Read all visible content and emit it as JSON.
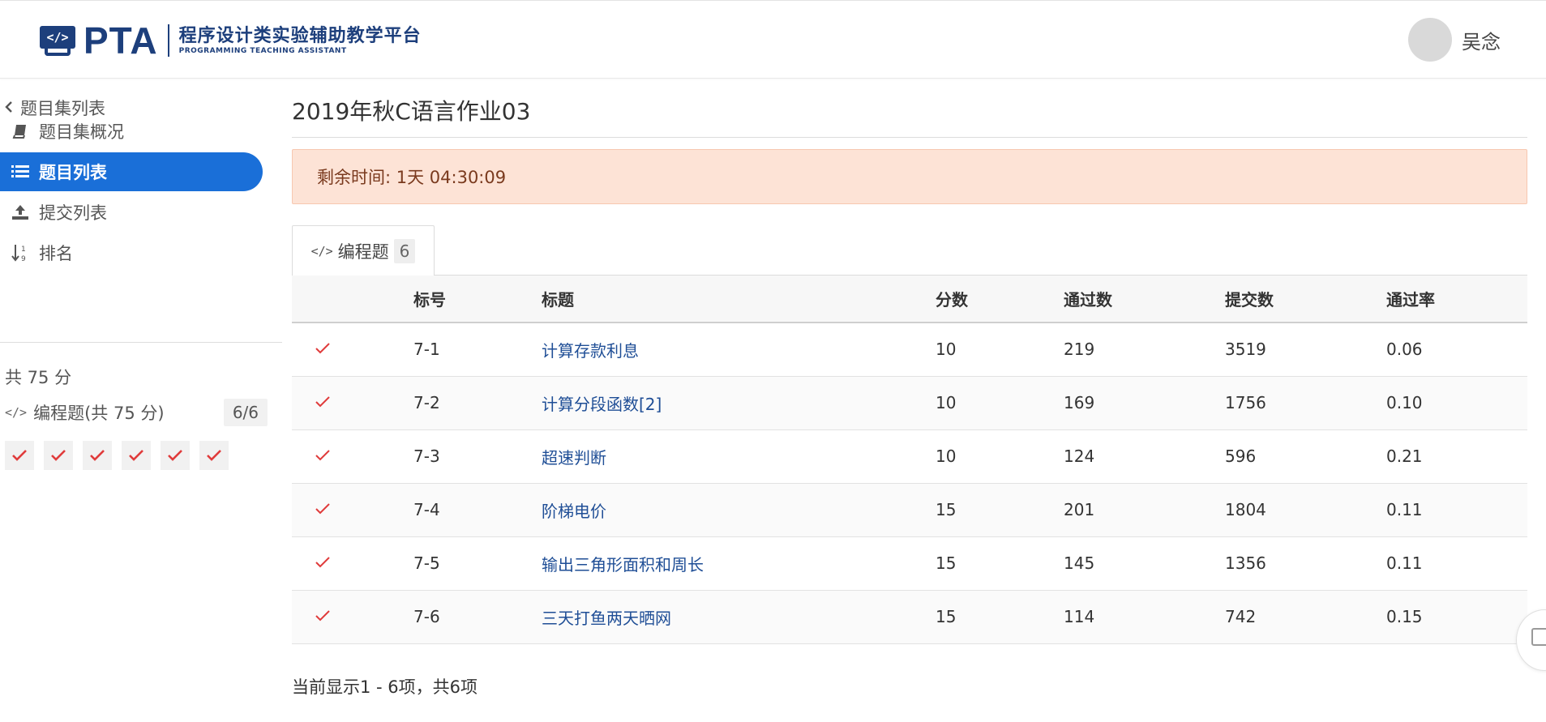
{
  "header": {
    "logo_text": "PTA",
    "logo_cn": "程序设计类实验辅助教学平台",
    "logo_en": "PROGRAMMING TEACHING ASSISTANT",
    "user_name": "吴念"
  },
  "sidebar": {
    "back_label": "题目集列表",
    "items": [
      {
        "label": "题目集概况",
        "icon": "book-icon"
      },
      {
        "label": "题目列表",
        "icon": "list-icon",
        "active": true
      },
      {
        "label": "提交列表",
        "icon": "upload-icon"
      },
      {
        "label": "排名",
        "icon": "sort-numeric-icon"
      }
    ],
    "total_score": "共 75 分",
    "type_label": "编程题(共 75 分)",
    "type_count": "6/6",
    "solved_count": 6
  },
  "main": {
    "title": "2019年秋C语言作业03",
    "timer": "剩余时间: 1天 04:30:09",
    "tab": {
      "label": "编程题",
      "count": "6"
    },
    "columns": [
      "",
      "标号",
      "标题",
      "分数",
      "通过数",
      "提交数",
      "通过率"
    ],
    "rows": [
      {
        "id": "7-1",
        "title": "计算存款利息",
        "score": "10",
        "passed": "219",
        "submitted": "3519",
        "rate": "0.06"
      },
      {
        "id": "7-2",
        "title": "计算分段函数[2]",
        "score": "10",
        "passed": "169",
        "submitted": "1756",
        "rate": "0.10"
      },
      {
        "id": "7-3",
        "title": "超速判断",
        "score": "10",
        "passed": "124",
        "submitted": "596",
        "rate": "0.21"
      },
      {
        "id": "7-4",
        "title": "阶梯电价",
        "score": "15",
        "passed": "201",
        "submitted": "1804",
        "rate": "0.11"
      },
      {
        "id": "7-5",
        "title": "输出三角形面积和周长",
        "score": "15",
        "passed": "145",
        "submitted": "1356",
        "rate": "0.11"
      },
      {
        "id": "7-6",
        "title": "三天打鱼两天晒网",
        "score": "15",
        "passed": "114",
        "submitted": "742",
        "rate": "0.15"
      }
    ],
    "footer_info": "当前显示1 - 6项，共6项"
  },
  "colors": {
    "accent": "#1a6fd8",
    "brand": "#1d3f7c",
    "check": "#e03b3b",
    "timer_bg": "#fde3d6",
    "link": "#1f4e96"
  }
}
